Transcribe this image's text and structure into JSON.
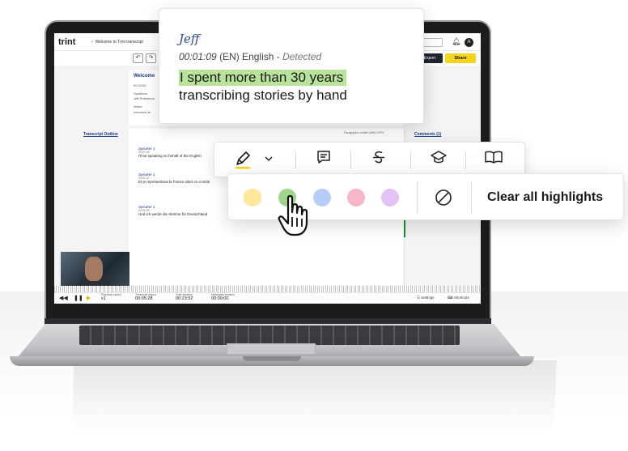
{
  "app": {
    "logo": "trint",
    "breadcrumb": "Welcome to Trint transcript",
    "avatar_initial": "A",
    "export_label": "Export",
    "share_label": "Share"
  },
  "document": {
    "title": "Welcome",
    "meta": [
      "00:23:52",
      "Speakers",
      "Jeff Rothmans",
      "Notes",
      "Interview wi"
    ],
    "outline_label": "Transcript Outline",
    "paragraph_status": "Paragraphs verified (###) 100%",
    "comments_label": "Comments (1)",
    "segments": [
      {
        "speaker": "Speaker 1",
        "time": "00:00:46",
        "text": "I'll be speaking on behalf of the English"
      },
      {
        "speaker": "Speaker 1",
        "time": "00:01:27",
        "text": "Et je représentarai la France dans ce comité"
      },
      {
        "speaker": "Speaker 1",
        "time": "00:01:59",
        "text": "Und ich werde die Stimme für Deutschland"
      }
    ]
  },
  "player": {
    "playback_speed_label": "Playback speed",
    "playback_speed_value": "x1",
    "timecode_label": "Timecode Adjust",
    "timecode_value": "00:05:28",
    "total_label": "Total duration",
    "total_value": "00:23:52",
    "highlight_label": "Highlights duration",
    "highlight_value": "00:00:00",
    "settings_label": "Settings",
    "shortcuts_label": "Shortcuts"
  },
  "popup": {
    "speaker": "Jeff",
    "time": "00:01:09",
    "language": "(EN) English",
    "separator": " - ",
    "detected": "Detected",
    "line1": "I spent more than 30 years",
    "line2": "transcribing stories by hand",
    "highlight_color": "#b9e39a"
  },
  "toolbar": {
    "items": [
      "highlighter-icon",
      "chevron-down-icon",
      "comment-icon",
      "strikethrough-icon",
      "graduation-cap-icon",
      "book-icon"
    ],
    "accent_color": "#f3d51b"
  },
  "highlight_colors": {
    "swatches": [
      "#fde79a",
      "#9fd58a",
      "#b6cdf9",
      "#f8b6c9",
      "#e2c3f6"
    ],
    "clear_label": "Clear all highlights"
  }
}
